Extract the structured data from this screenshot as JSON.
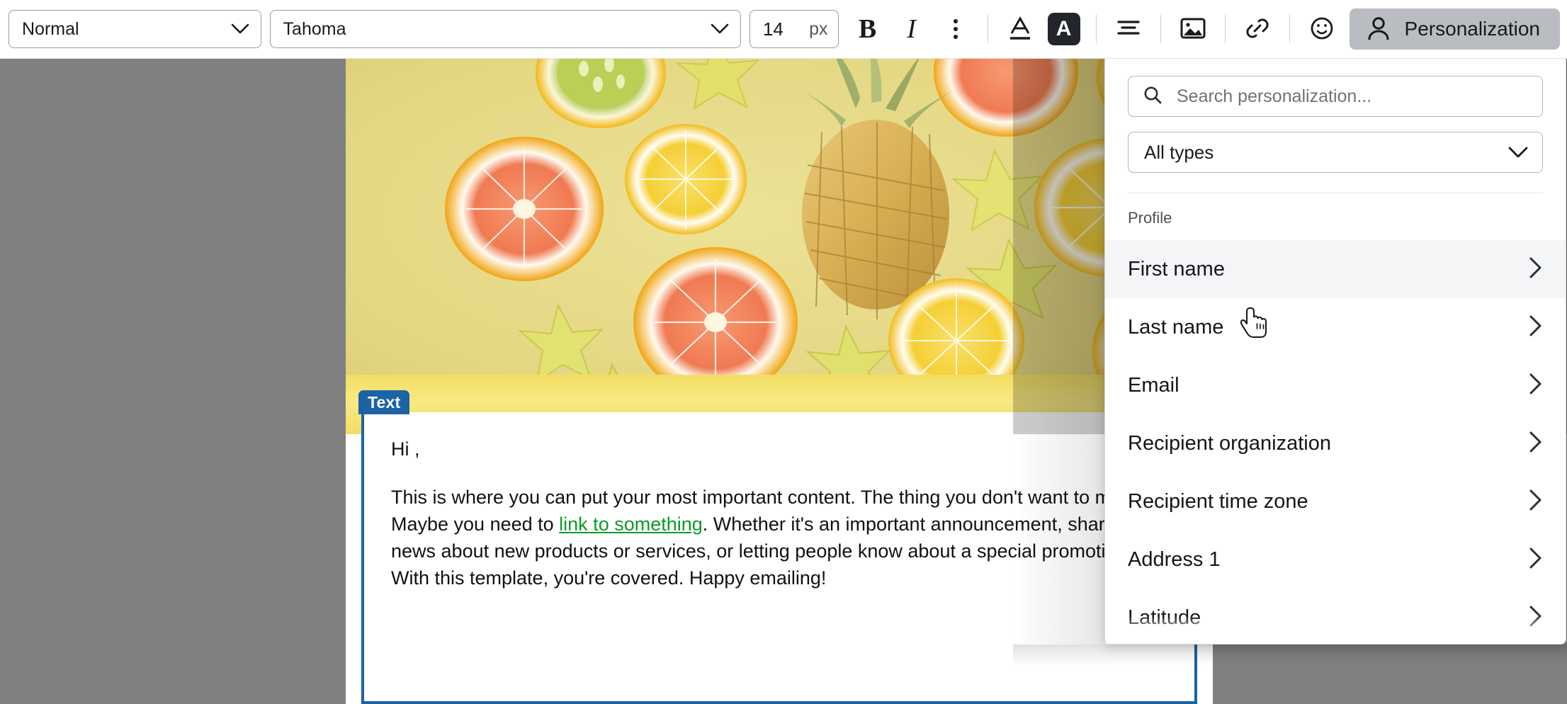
{
  "toolbar": {
    "paragraph_style": {
      "value": "Normal",
      "icon": "chevron-down-icon"
    },
    "font_family": {
      "value": "Tahoma",
      "icon": "chevron-down-icon"
    },
    "font_size": {
      "value": "14",
      "unit": "px"
    },
    "bold_label": "B",
    "italic_label": "I",
    "more_options_icon": "kebab-menu-icon",
    "text_color_icon": "text-color-icon",
    "highlight_letter": "A",
    "highlight_icon": "text-highlight-icon",
    "align_icon": "align-center-icon",
    "image_icon": "insert-image-icon",
    "link_icon": "insert-link-icon",
    "emoji_icon": "emoji-icon",
    "personalization": {
      "label": "Personalization",
      "icon": "person-icon",
      "active": true
    }
  },
  "email": {
    "hero": {
      "alt": "citrus fruit slices and pineapple on yellow background"
    },
    "text_block": {
      "badge": "Text",
      "greeting": "Hi ,",
      "paragraph_before_link": "This is where you can put your most important content. The thing you don't want to miss. Maybe you need to ",
      "link_text": "link to something",
      "paragraph_after_link": ". Whether it's an important announcement, sharing news about new products or services, or letting people know about a special promotion. With this template, you're covered. Happy emailing!",
      "link_color": "#0d9a27",
      "border_color": "#1b63a5"
    }
  },
  "personalization_panel": {
    "search": {
      "placeholder": "Search personalization...",
      "value": "",
      "icon": "search-icon"
    },
    "type_filter": {
      "value": "All types",
      "icon": "chevron-down-icon"
    },
    "group_label": "Profile",
    "items": [
      {
        "label": "First name",
        "icon": "chevron-right-icon",
        "hovered": true
      },
      {
        "label": "Last name",
        "icon": "chevron-right-icon",
        "hovered": false
      },
      {
        "label": "Email",
        "icon": "chevron-right-icon",
        "hovered": false
      },
      {
        "label": "Recipient organization",
        "icon": "chevron-right-icon",
        "hovered": false
      },
      {
        "label": "Recipient time zone",
        "icon": "chevron-right-icon",
        "hovered": false
      },
      {
        "label": "Address 1",
        "icon": "chevron-right-icon",
        "hovered": false
      },
      {
        "label": "Latitude",
        "icon": "chevron-right-icon",
        "hovered": false
      }
    ]
  },
  "cursor": {
    "icon": "pointer-hand-cursor"
  },
  "colors": {
    "accent_blue": "#1b63a5",
    "canvas_gray": "#808080",
    "toolbar_active": "#b9bcc0",
    "link_green": "#0d9a27"
  }
}
